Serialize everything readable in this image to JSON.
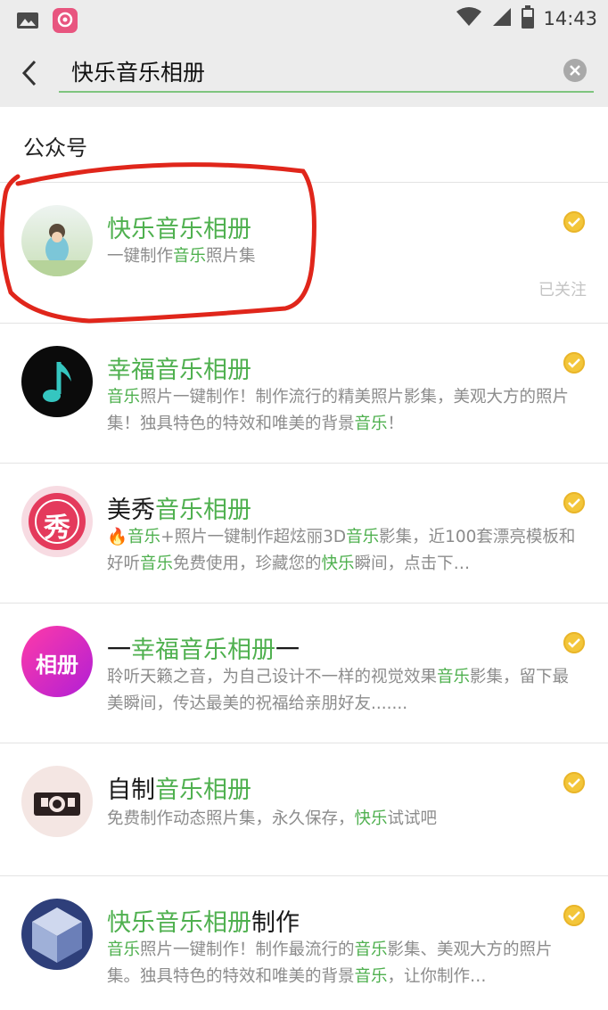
{
  "status_bar": {
    "time": "14:43",
    "icons": [
      "gallery-icon",
      "app-icon",
      "wifi-icon",
      "signal-icon",
      "battery-icon"
    ]
  },
  "search": {
    "query": "快乐音乐相册"
  },
  "section": {
    "title": "公众号"
  },
  "accounts": [
    {
      "title_parts": [
        {
          "t": "快乐音乐相册",
          "hl": true
        }
      ],
      "desc_parts": [
        {
          "t": "一键制作",
          "hl": false
        },
        {
          "t": "音乐",
          "hl": true
        },
        {
          "t": "照片集",
          "hl": false
        }
      ],
      "followed": "已关注"
    },
    {
      "title_parts": [
        {
          "t": "幸福音乐相册",
          "hl": true
        }
      ],
      "desc_parts": [
        {
          "t": "音乐",
          "hl": true
        },
        {
          "t": "照片一键制作！制作流行的精美照片影集，美观大方的照片集！独具特色的特效和唯美的背景",
          "hl": false
        },
        {
          "t": "音乐",
          "hl": true
        },
        {
          "t": "！",
          "hl": false
        }
      ]
    },
    {
      "title_parts": [
        {
          "t": "美秀",
          "hl": false
        },
        {
          "t": "音乐相册",
          "hl": true
        }
      ],
      "desc_parts": [
        {
          "t": "🔥",
          "hl": false
        },
        {
          "t": "音乐",
          "hl": true
        },
        {
          "t": "+照片一键制作超炫丽3D",
          "hl": false
        },
        {
          "t": "音乐",
          "hl": true
        },
        {
          "t": "影集，近100套漂亮模板和好听",
          "hl": false
        },
        {
          "t": "音乐",
          "hl": true
        },
        {
          "t": "免费使用，珍藏您的",
          "hl": false
        },
        {
          "t": "快乐",
          "hl": true
        },
        {
          "t": "瞬间，点击下…",
          "hl": false
        }
      ]
    },
    {
      "title_parts": [
        {
          "t": "一",
          "hl": false
        },
        {
          "t": "幸福音乐相册",
          "hl": true
        },
        {
          "t": "一",
          "hl": false
        }
      ],
      "desc_parts": [
        {
          "t": "聆听天籁之音，为自己设计不一样的视觉效果",
          "hl": false
        },
        {
          "t": "音乐",
          "hl": true
        },
        {
          "t": "影集，留下最美瞬间，传达最美的祝福给亲朋好友.......",
          "hl": false
        }
      ]
    },
    {
      "title_parts": [
        {
          "t": "自制",
          "hl": false
        },
        {
          "t": "音乐相册",
          "hl": true
        }
      ],
      "desc_parts": [
        {
          "t": "免费制作动态照片集，永久保存，",
          "hl": false
        },
        {
          "t": "快乐",
          "hl": true
        },
        {
          "t": "试试吧",
          "hl": false
        }
      ]
    },
    {
      "title_parts": [
        {
          "t": "快乐音乐相册",
          "hl": true
        },
        {
          "t": "制作",
          "hl": false
        }
      ],
      "desc_parts": [
        {
          "t": "音乐",
          "hl": true
        },
        {
          "t": "照片一键制作！制作最流行的",
          "hl": false
        },
        {
          "t": "音乐",
          "hl": true
        },
        {
          "t": "影集、美观大方的照片集。独具特色的特效和唯美的背景",
          "hl": false
        },
        {
          "t": "音乐",
          "hl": true
        },
        {
          "t": "，让你制作…",
          "hl": false
        }
      ]
    }
  ],
  "avatar_labels": {
    "xiu": "秀",
    "xiangce": "相册"
  },
  "colors": {
    "highlight": "#4fb04f",
    "accent_line": "#7ec57e",
    "verified": "#f3c63a",
    "annotation": "#e0261b"
  }
}
